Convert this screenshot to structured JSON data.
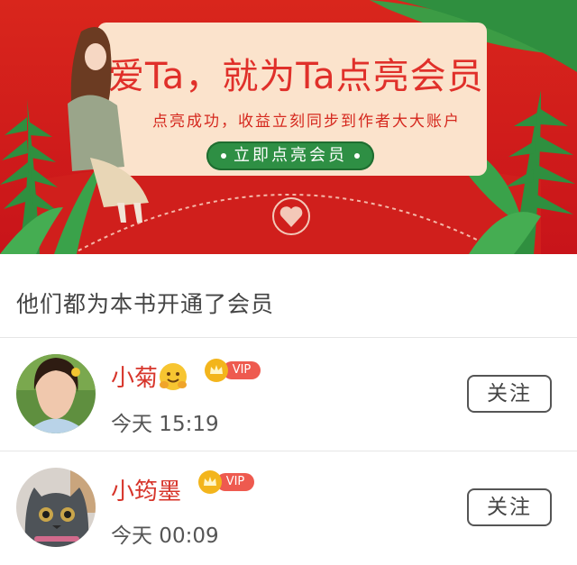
{
  "banner": {
    "headline": "爱Ta，就为Ta点亮会员",
    "subline": "点亮成功，收益立刻同步到作者大大账户",
    "cta_label": "立即点亮会员",
    "colors": {
      "background": "#d9261c",
      "card": "#fbe3cc",
      "cta": "#2e8f44",
      "leaf": "#2f8f3f"
    }
  },
  "section": {
    "title": "他们都为本书开通了会员"
  },
  "members": [
    {
      "name": "小菊",
      "time": "今天 15:19",
      "badge": "VIP",
      "follow_label": "关注",
      "emoji_icon": "hugging-face-emoji"
    },
    {
      "name": "小筠墨",
      "time": "今天 00:09",
      "badge": "VIP",
      "follow_label": "关注"
    }
  ]
}
